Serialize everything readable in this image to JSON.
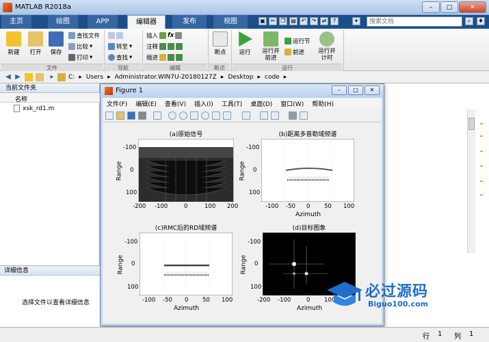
{
  "window": {
    "title": "MATLAB R2018a",
    "min": "–",
    "max": "□",
    "close": "✕"
  },
  "tabs": [
    {
      "label": "主页"
    },
    {
      "label": "绘图"
    },
    {
      "label": "APP"
    },
    {
      "label": "编辑器"
    },
    {
      "label": "发布"
    },
    {
      "label": "视图"
    }
  ],
  "search": {
    "placeholder": "搜索文档"
  },
  "ribbon": {
    "new": "新建",
    "open": "打开",
    "save": "保存",
    "find_files": "查找文件",
    "compare": "比较",
    "print": "打印",
    "goto": "转至",
    "find": "查找",
    "insert": "插入",
    "comment": "注释",
    "indent": "缩进",
    "breakpoints": "断点",
    "run": "运行",
    "run_advance": "运行并\n前进",
    "run_section": "运行节",
    "advance": "前进",
    "run_time": "运行并\n计时",
    "groups": {
      "file": "文件",
      "nav": "导航",
      "edit": "编辑",
      "bp": "断点",
      "run": "运行"
    },
    "fx": "fx"
  },
  "address": {
    "segments": [
      "C:",
      "Users",
      "Administrator.WIN7U-20180127Z",
      "Desktop",
      "code"
    ]
  },
  "leftpanel": {
    "title": "当前文件夹",
    "col_name": "名称",
    "files": [
      {
        "name": "xsk_rd1.m"
      }
    ],
    "details_title": "详细信息",
    "details_hint": "选择文件以查看详细信息"
  },
  "statusbar": {
    "row_label": "行",
    "row": "1",
    "col_label": "列",
    "col": "1"
  },
  "figure": {
    "title": "Figure 1",
    "menu": [
      "文件(F)",
      "编辑(E)",
      "查看(V)",
      "插入(I)",
      "工具(T)",
      "桌面(D)",
      "窗口(W)",
      "帮助(H)"
    ],
    "subplots": [
      {
        "title": "(a)原始信号",
        "ylabel": "Range",
        "xlabel": "",
        "xticks": [
          "-200",
          "-100",
          "0",
          "100",
          "200"
        ],
        "yticks": [
          "-100",
          "0",
          "100"
        ]
      },
      {
        "title": "(b)距离多普勒域频谱",
        "ylabel": "Range",
        "xlabel": "Azimuth",
        "xticks": [
          "-100",
          "-50",
          "0",
          "50",
          "100"
        ],
        "yticks": [
          "-100",
          "0",
          "100"
        ]
      },
      {
        "title": "(c)RMC后的RD域频谱",
        "ylabel": "Range",
        "xlabel": "Azimuth",
        "xticks": [
          "-100",
          "-50",
          "0",
          "50",
          "100"
        ],
        "yticks": [
          "-100",
          "0",
          "100"
        ]
      },
      {
        "title": "(d)目标图象",
        "ylabel": "Range",
        "xlabel": "Azimuth",
        "xticks": [
          "-200",
          "-100",
          "0",
          "100"
        ],
        "yticks": [
          "-100",
          "0",
          "100"
        ]
      }
    ]
  },
  "watermark": {
    "text": "必过源码",
    "sub": "Biguo100.com"
  }
}
